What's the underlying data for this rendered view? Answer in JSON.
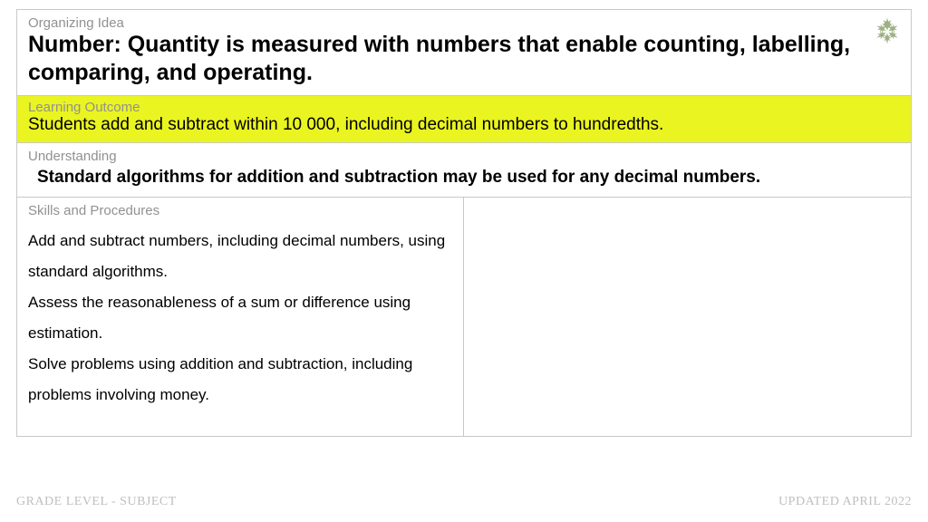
{
  "organizing": {
    "label": "Organizing Idea",
    "title": "Number: Quantity is measured with numbers that enable counting, labelling, comparing, and operating."
  },
  "learning": {
    "label": "Learning Outcome",
    "text": "Students add and subtract within 10 000, including decimal numbers to hundredths."
  },
  "understanding": {
    "label": "Understanding",
    "text": "Standard algorithms for addition and subtraction may be used for any decimal numbers."
  },
  "skills": {
    "label": "Skills and Procedures",
    "items": [
      "Add and subtract numbers, including decimal numbers, using standard algorithms.",
      "Assess the reasonableness of a sum or difference using estimation.",
      "Solve problems using addition and subtraction, including problems involving money."
    ]
  },
  "footer": {
    "left": "GRADE LEVEL - SUBJECT",
    "right": "UPDATED APRIL 2022"
  }
}
